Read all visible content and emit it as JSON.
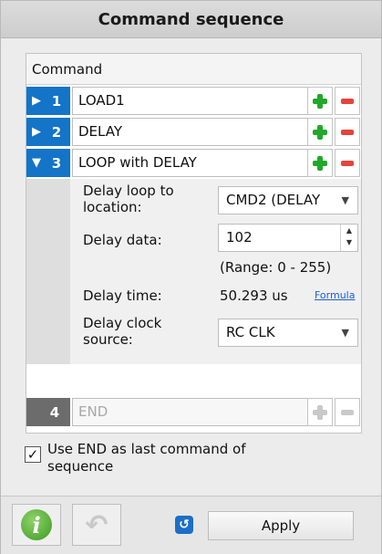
{
  "panel": {
    "title": "Command sequence"
  },
  "sequence": {
    "header": "Command",
    "commands": [
      {
        "index": "1",
        "label": "LOAD1",
        "expanded": false
      },
      {
        "index": "2",
        "label": "DELAY",
        "expanded": false
      },
      {
        "index": "3",
        "label": "LOOP with DELAY",
        "expanded": true
      },
      {
        "index": "4",
        "label": "END",
        "disabled": true
      }
    ],
    "details": {
      "delay_loop_label": "Delay loop to location:",
      "delay_loop_value": "CMD2 (DELAY",
      "delay_data_label": "Delay data:",
      "delay_data_value": "102",
      "range_text": "(Range:  0 - 255)",
      "delay_time_label": "Delay time:",
      "delay_time_value": "50.293 us",
      "formula_link": "Formula",
      "clock_source_label": "Delay clock source:",
      "clock_source_value": "RC CLK"
    }
  },
  "end_option": {
    "label": "Use END as last command of sequence",
    "checked": true
  },
  "toolbar": {
    "apply_label": "Apply"
  },
  "colors": {
    "index_blue": "#1474c8",
    "add_green": "#22a82a",
    "remove_red": "#e3443c"
  }
}
